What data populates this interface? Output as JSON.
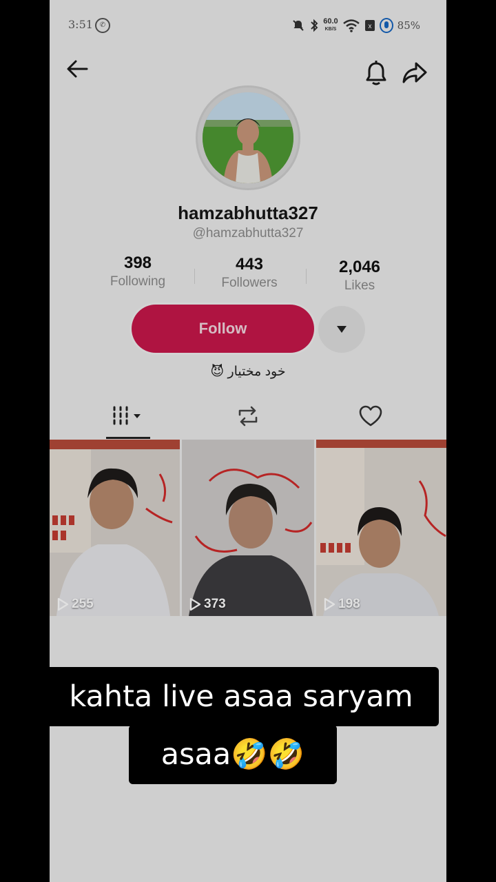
{
  "status_bar": {
    "time": "3:51",
    "network_speed_top": "60.0",
    "network_speed_bottom": "KB/S",
    "battery_percent": "85%"
  },
  "profile": {
    "username": "hamzabhutta327",
    "handle": "@hamzabhutta327",
    "bio": "خود مختیار 😈",
    "stats": [
      {
        "value": "398",
        "label": "Following"
      },
      {
        "value": "443",
        "label": "Followers"
      },
      {
        "value": "2,046",
        "label": "Likes"
      }
    ],
    "follow_label": "Follow"
  },
  "videos": [
    {
      "views": "255"
    },
    {
      "views": "373"
    },
    {
      "views": "198"
    }
  ],
  "caption": {
    "line1": "kahta live asaa saryam",
    "line2": "asaa🤣🤣"
  },
  "colors": {
    "follow_button": "#c8174a",
    "caption_bg": "#000000"
  }
}
